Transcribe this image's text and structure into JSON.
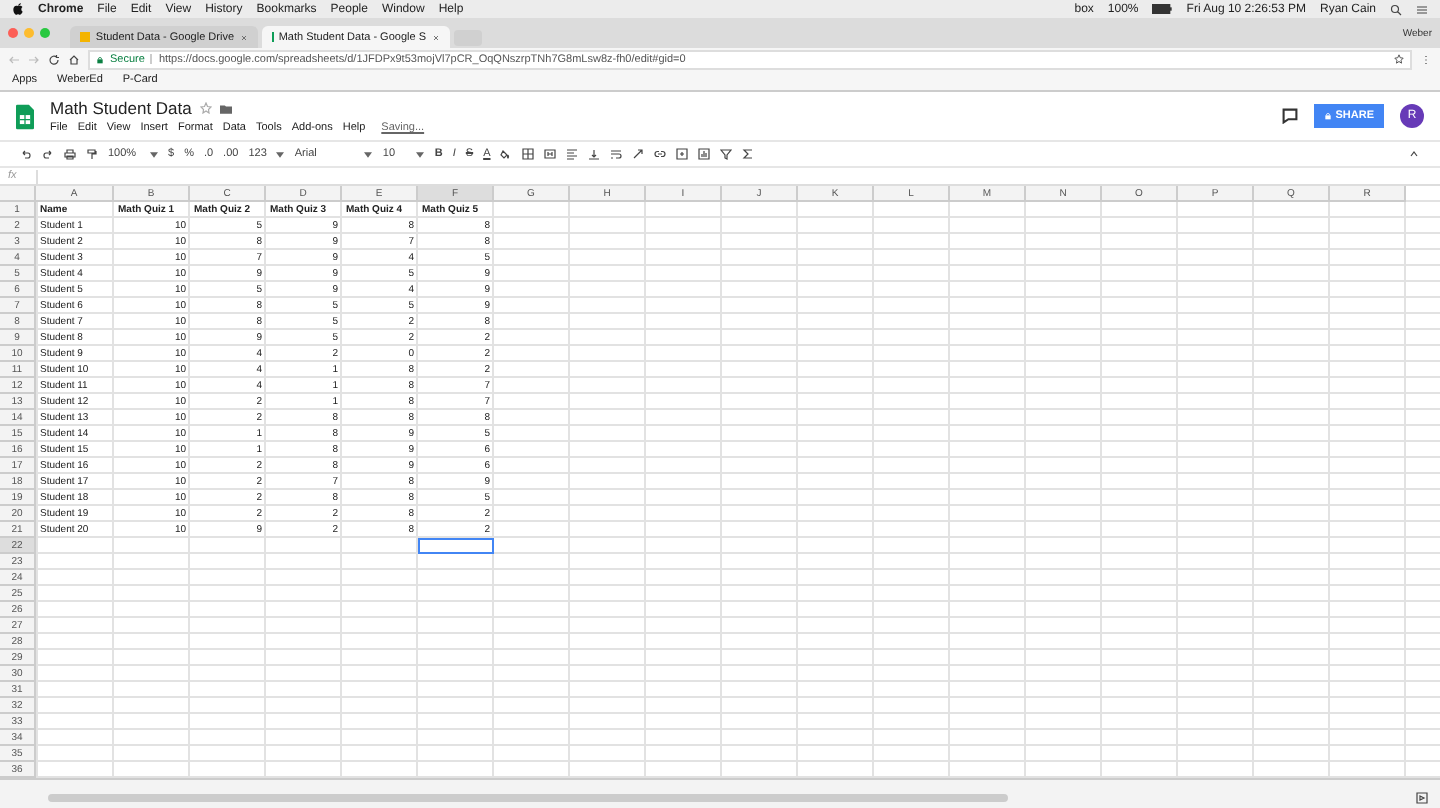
{
  "menubar": {
    "app": "Chrome",
    "menus": [
      "File",
      "Edit",
      "View",
      "History",
      "Bookmarks",
      "People",
      "Window",
      "Help"
    ],
    "status": [
      "box",
      "100%",
      "Fri Aug 10  2:26:53 PM",
      "Ryan Cain"
    ]
  },
  "browser_tabs": [
    {
      "title": "Student Data - Google Drive",
      "selected": false
    },
    {
      "title": "Math Student Data - Google S",
      "selected": true
    }
  ],
  "profile": "Weber",
  "address": {
    "secure": "Secure",
    "url": "https://docs.google.com/spreadsheets/d/1JFDPx9t53mojVl7pCR_OqQNszrpTNh7G8mLsw8z-fh0/edit#gid=0"
  },
  "bookmarks": [
    "Apps",
    "WeberEd",
    "P-Card"
  ],
  "document": {
    "title": "Math Student Data",
    "menus": [
      "File",
      "Edit",
      "View",
      "Insert",
      "Format",
      "Data",
      "Tools",
      "Add-ons",
      "Help"
    ],
    "status": "Saving...",
    "share": "SHARE",
    "avatar": "R"
  },
  "toolbar": {
    "zoom": "100%",
    "formats": [
      "$",
      "%",
      ".0",
      ".00",
      "123"
    ],
    "font": "Arial",
    "size": "10",
    "text_styles": [
      "B",
      "I",
      "S",
      "A"
    ],
    "formula_label": "fx"
  },
  "columns": [
    {
      "label": "A",
      "selected": false
    },
    {
      "label": "B",
      "selected": false
    },
    {
      "label": "C",
      "selected": false
    },
    {
      "label": "D",
      "selected": false
    },
    {
      "label": "E",
      "selected": false
    },
    {
      "label": "F",
      "selected": true
    },
    {
      "label": "G",
      "selected": false
    },
    {
      "label": "H",
      "selected": false
    },
    {
      "label": "I",
      "selected": false
    },
    {
      "label": "J",
      "selected": false
    },
    {
      "label": "K",
      "selected": false
    },
    {
      "label": "L",
      "selected": false
    },
    {
      "label": "M",
      "selected": false
    },
    {
      "label": "N",
      "selected": false
    },
    {
      "label": "O",
      "selected": false
    },
    {
      "label": "P",
      "selected": false
    },
    {
      "label": "Q",
      "selected": false
    },
    {
      "label": "R",
      "selected": false
    }
  ],
  "rows": [
    {
      "number": "1",
      "selected": false,
      "cells": [
        "Name",
        "Math Quiz 1",
        "Math Quiz 2",
        "Math Quiz 3",
        "Math Quiz 4",
        "Math Quiz 5"
      ]
    },
    {
      "number": "2",
      "selected": false,
      "cells": [
        "Student 1",
        "10",
        "5",
        "9",
        "8",
        "8"
      ]
    },
    {
      "number": "3",
      "selected": false,
      "cells": [
        "Student 2",
        "10",
        "8",
        "9",
        "7",
        "8"
      ]
    },
    {
      "number": "4",
      "selected": false,
      "cells": [
        "Student 3",
        "10",
        "7",
        "9",
        "4",
        "5"
      ]
    },
    {
      "number": "5",
      "selected": false,
      "cells": [
        "Student 4",
        "10",
        "9",
        "9",
        "5",
        "9"
      ]
    },
    {
      "number": "6",
      "selected": false,
      "cells": [
        "Student 5",
        "10",
        "5",
        "9",
        "4",
        "9"
      ]
    },
    {
      "number": "7",
      "selected": false,
      "cells": [
        "Student 6",
        "10",
        "8",
        "5",
        "5",
        "9"
      ]
    },
    {
      "number": "8",
      "selected": false,
      "cells": [
        "Student 7",
        "10",
        "8",
        "5",
        "2",
        "8"
      ]
    },
    {
      "number": "9",
      "selected": false,
      "cells": [
        "Student 8",
        "10",
        "9",
        "5",
        "2",
        "2"
      ]
    },
    {
      "number": "10",
      "selected": false,
      "cells": [
        "Student 9",
        "10",
        "4",
        "2",
        "0",
        "2"
      ]
    },
    {
      "number": "11",
      "selected": false,
      "cells": [
        "Student 10",
        "10",
        "4",
        "1",
        "8",
        "2"
      ]
    },
    {
      "number": "12",
      "selected": false,
      "cells": [
        "Student 11",
        "10",
        "4",
        "1",
        "8",
        "7"
      ]
    },
    {
      "number": "13",
      "selected": false,
      "cells": [
        "Student 12",
        "10",
        "2",
        "1",
        "8",
        "7"
      ]
    },
    {
      "number": "14",
      "selected": false,
      "cells": [
        "Student 13",
        "10",
        "2",
        "8",
        "8",
        "8"
      ]
    },
    {
      "number": "15",
      "selected": false,
      "cells": [
        "Student 14",
        "10",
        "1",
        "8",
        "9",
        "5"
      ]
    },
    {
      "number": "16",
      "selected": false,
      "cells": [
        "Student 15",
        "10",
        "1",
        "8",
        "9",
        "6"
      ]
    },
    {
      "number": "17",
      "selected": false,
      "cells": [
        "Student 16",
        "10",
        "2",
        "8",
        "9",
        "6"
      ]
    },
    {
      "number": "18",
      "selected": false,
      "cells": [
        "Student 17",
        "10",
        "2",
        "7",
        "8",
        "9"
      ]
    },
    {
      "number": "19",
      "selected": false,
      "cells": [
        "Student 18",
        "10",
        "2",
        "8",
        "8",
        "5"
      ]
    },
    {
      "number": "20",
      "selected": false,
      "cells": [
        "Student 19",
        "10",
        "2",
        "2",
        "8",
        "2"
      ]
    },
    {
      "number": "21",
      "selected": false,
      "cells": [
        "Student 20",
        "10",
        "9",
        "2",
        "8",
        "2"
      ]
    },
    {
      "number": "22",
      "selected": true
    },
    {
      "number": "23",
      "selected": false
    },
    {
      "number": "24",
      "selected": false
    },
    {
      "number": "25",
      "selected": false
    },
    {
      "number": "26",
      "selected": false
    },
    {
      "number": "27",
      "selected": false
    },
    {
      "number": "28",
      "selected": false
    },
    {
      "number": "29",
      "selected": false
    },
    {
      "number": "30",
      "selected": false
    },
    {
      "number": "31",
      "selected": false
    },
    {
      "number": "32",
      "selected": false
    },
    {
      "number": "33",
      "selected": false
    },
    {
      "number": "34",
      "selected": false
    },
    {
      "number": "35",
      "selected": false
    },
    {
      "number": "36",
      "selected": false
    }
  ]
}
